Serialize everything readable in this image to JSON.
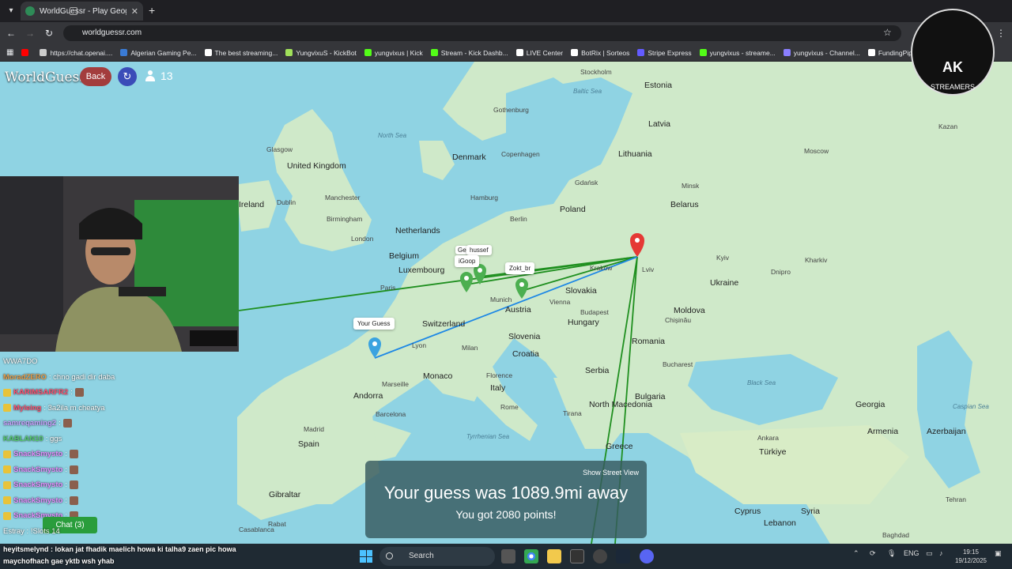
{
  "browser": {
    "tab_title": "WorldGuessr - Play Geoguessr F",
    "url": "worldguessr.com",
    "bookmarks": [
      {
        "label": "",
        "color": "#ff0000",
        "icon": "youtube-icon"
      },
      {
        "label": "https://chat.openai....",
        "color": "#cccccc",
        "icon": "openai-icon"
      },
      {
        "label": "Algerian Gaming Pe...",
        "color": "#3a7bd5",
        "icon": "globe-icon"
      },
      {
        "label": "The best streaming...",
        "color": "#ffffff",
        "icon": "diamond-icon"
      },
      {
        "label": "YungvixuS - KickBot",
        "color": "#a0e05a",
        "icon": "kickbot-icon"
      },
      {
        "label": "yungvixus | Kick",
        "color": "#53fc18",
        "icon": "kick-icon"
      },
      {
        "label": "Stream - Kick Dashb...",
        "color": "#53fc18",
        "icon": "kick-icon"
      },
      {
        "label": "LIVE Center",
        "color": "#ffffff",
        "icon": "tiktok-icon"
      },
      {
        "label": "BotRix | Sorteos",
        "color": "#ffffff",
        "icon": "diamond-icon"
      },
      {
        "label": "Stripe Express",
        "color": "#635bff",
        "icon": "stripe-icon"
      },
      {
        "label": "yungvixus - streame...",
        "color": "#53fc18",
        "icon": "kick-icon"
      },
      {
        "label": "yungvixus - Channel...",
        "color": "#8a7fff",
        "icon": "channel-icon"
      },
      {
        "label": "FundingPips",
        "color": "#ffffff",
        "icon": "fundingpips-icon"
      }
    ]
  },
  "game": {
    "logo": "WorldGuessr",
    "back_label": "Back",
    "player_count": "13",
    "result_main": "Your guess was 1089.9mi away",
    "result_points": "You got 2080 points!",
    "street_view_label": "Show Street View",
    "tags": {
      "your_guess": "Your Guess",
      "tag1": "Gen",
      "tag2": "hussef",
      "tag3": "iGoop",
      "tag4": "Zokt_br"
    }
  },
  "map_labels": {
    "countries": [
      "United Kingdom",
      "Ireland",
      "Netherlands",
      "Belgium",
      "Luxembourg",
      "Denmark",
      "Poland",
      "Belarus",
      "Lithuania",
      "Latvia",
      "Estonia",
      "Ukraine",
      "Moldova",
      "Romania",
      "Bulgaria",
      "Serbia",
      "Hungary",
      "Slovakia",
      "Austria",
      "Switzerland",
      "Slovenia",
      "Croatia",
      "Italy",
      "Monaco",
      "Andorra",
      "Spain",
      "Gibraltar",
      "Greece",
      "North Macedonia",
      "Türkiye",
      "Georgia",
      "Armenia",
      "Azerbaijan",
      "Cyprus",
      "Syria",
      "Lebanon"
    ],
    "cities": [
      "Stockholm",
      "Gothenburg",
      "Copenhagen",
      "Hamburg",
      "Berlin",
      "Gdańsk",
      "Glasgow",
      "Dublin",
      "Manchester",
      "Birmingham",
      "London",
      "Paris",
      "Lyon",
      "Marseille",
      "Barcelona",
      "Madrid",
      "Rabat",
      "Casablanca",
      "Milan",
      "Florence",
      "Rome",
      "Munich",
      "Vienna",
      "Budapest",
      "Bucharest",
      "Kraków",
      "Lviv",
      "Kyiv",
      "Minsk",
      "Moscow",
      "Kazan",
      "Dnipro",
      "Kharkiv",
      "Chișinău",
      "Tirana",
      "Ankara",
      "Baghdad",
      "Tehran"
    ],
    "seas": [
      "North Sea",
      "Baltic Sea",
      "Black Sea",
      "Caspian Sea",
      "Tyrrhenian Sea"
    ]
  },
  "streamer_overlay": {
    "logo_text": "AK",
    "logo_sub": "STREAMERS"
  },
  "chat": {
    "header": "WWA7DO",
    "messages": [
      {
        "user": "MoradZERO",
        "text": ": chno gadi dir daba",
        "color": "#e89b45",
        "badge": false,
        "emote": false
      },
      {
        "user": "KARIMSARFR2",
        "text": ":",
        "color": "#ff4d6d",
        "badge": true,
        "emote": true
      },
      {
        "user": "Myleing",
        "text": ": 3a2ila m cheatya",
        "color": "#ff4d6d",
        "badge": true,
        "emote": false
      },
      {
        "user": "samreqaming2",
        "text": ":",
        "color": "#c8a2ff",
        "badge": false,
        "emote": true
      },
      {
        "user": "KABLAN10",
        "text": ": ggs",
        "color": "#53c96b",
        "badge": false,
        "emote": false
      },
      {
        "user": "SnackSmysto",
        "text": ":",
        "color": "#e58cff",
        "badge": true,
        "emote": true
      },
      {
        "user": "SnackSmysto",
        "text": ":",
        "color": "#e58cff",
        "badge": true,
        "emote": true
      },
      {
        "user": "SnackSmysto",
        "text": ":",
        "color": "#e58cff",
        "badge": true,
        "emote": true
      },
      {
        "user": "SnackSmysto",
        "text": ":",
        "color": "#e58cff",
        "badge": true,
        "emote": true
      },
      {
        "user": "SnackSmysto",
        "text": ":",
        "color": "#e58cff",
        "badge": true,
        "emote": true
      }
    ],
    "chat_pill": "Chat (3)",
    "slots_text": "Estray : !Slots 14",
    "ticker": "heyitsmelynd : lokan jat fhadik maelich howa ki talha9 zaen pic howa maychofhach gae yktb wsh yhab"
  },
  "taskbar": {
    "search_placeholder": "Search",
    "lang": "ENG",
    "time": "19:15",
    "date": "19/12/2025"
  },
  "colors": {
    "map_sea": "#8fd3e3",
    "map_land": "#cfe9c9",
    "guess_line": "#1e88e5",
    "player_line": "#1f8f1f",
    "actual_pin": "#e53935",
    "back_button": "#a33d3d",
    "refresh_button": "#3b4cb8"
  }
}
